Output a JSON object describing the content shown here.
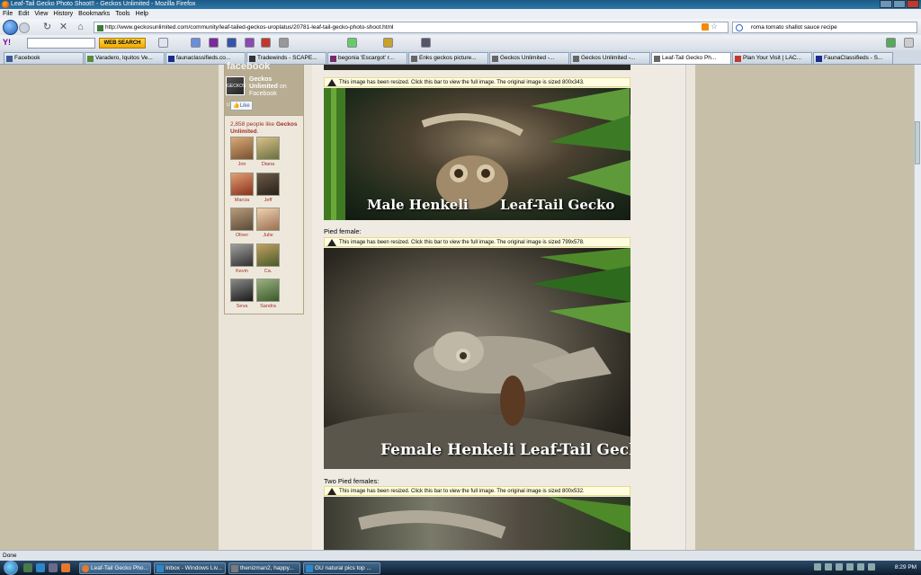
{
  "window": {
    "title": "Leaf-Tail Gecko Photo Shoot!! - Geckos Unlimited - Mozilla Firefox"
  },
  "menu": [
    "File",
    "Edit",
    "View",
    "History",
    "Bookmarks",
    "Tools",
    "Help"
  ],
  "address": {
    "url": "http://www.geckosunlimited.com/community/leaf-tailed-geckos-uroplatus/20781-leaf-tail-gecko-photo-shoot.html"
  },
  "search": {
    "value": "roma tomato shallot sauce recipe"
  },
  "yahoo_toolbar": {
    "logo": "Y!",
    "search_button": "WEB SEARCH"
  },
  "tabs": [
    {
      "label": "Facebook",
      "icon_color": "#3b5998"
    },
    {
      "label": "Varadero, Iquitos Ve...",
      "icon_color": "#5a8a3a"
    },
    {
      "label": "faunaclassifieds.co...",
      "icon_color": "#1a2b8c"
    },
    {
      "label": "Tradewinds - SCAPE...",
      "icon_color": "#333333"
    },
    {
      "label": "begonia 'Escargot' r...",
      "icon_color": "#7a2a6a"
    },
    {
      "label": "Enks geckos picture...",
      "icon_color": "#666666"
    },
    {
      "label": "Geckos Unlimited -...",
      "icon_color": "#666666"
    },
    {
      "label": "Geckos Unlimited -...",
      "icon_color": "#666666"
    },
    {
      "label": "Leaf-Tail Gecko Ph...",
      "icon_color": "#666666"
    },
    {
      "label": "Plan Your Visit | LAC...",
      "icon_color": "#c0392b"
    },
    {
      "label": "FaunaClassifieds - S...",
      "icon_color": "#1a2b8c"
    }
  ],
  "facebook_box": {
    "header_wordmark": "facebook",
    "page_logo_text": "GECKOS UNLIMITED",
    "page_name": "Geckos Unlimited",
    "on_text": " on Facebook",
    "like_button": "Like",
    "like_count_prefix": "2,858 people like ",
    "like_count_page": "Geckos Unlimited",
    "friends": [
      "Jon",
      "Diana",
      "Marcia",
      "Jeff",
      "Oliver",
      "Julie",
      "Kevin",
      "Ca.",
      "Seva",
      "Sandra"
    ]
  },
  "post": {
    "resize_notice_1": "This image has been resized. Click this bar to view the full image. The original image is sized 800x343.",
    "photo1_text_left": "Male Henkeli",
    "photo1_text_right": "Leaf-Tail Gecko",
    "caption_2": "Pied female:",
    "resize_notice_2": "This image has been resized. Click this bar to view the full image. The original image is sized 799x578.",
    "photo2_text": "Female Henkeli Leaf-Tail Gecko",
    "caption_3": "Two Pied females:",
    "resize_notice_3": "This image has been resized. Click this bar to view the full image. The original image is sized 800x532."
  },
  "status": {
    "text": "Done"
  },
  "taskbar": {
    "items": [
      {
        "label": "Leaf-Tail Gecko Pho...",
        "active": true,
        "icon_color": "#e8772e"
      },
      {
        "label": "Inbox - Windows Liv...",
        "active": false,
        "icon_color": "#2e86c8"
      },
      {
        "label": "thenizman2, happy...",
        "active": false,
        "icon_color": "#7a7a7a"
      },
      {
        "label": "GU natural pics top ...",
        "active": false,
        "icon_color": "#2e86c8"
      }
    ],
    "clock": "8:29 PM"
  }
}
